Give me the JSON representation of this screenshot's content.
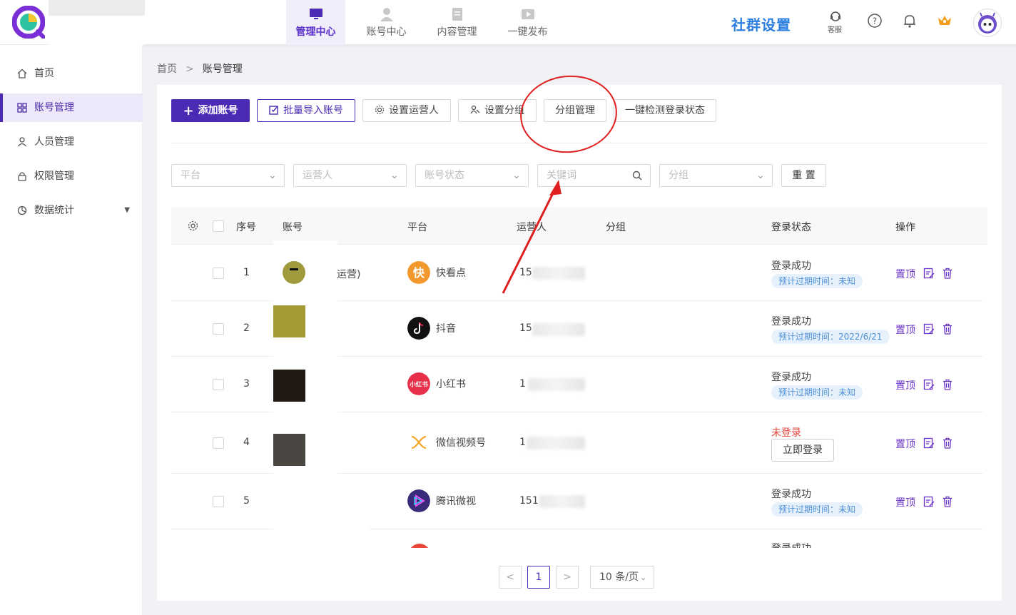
{
  "header": {
    "nav": [
      {
        "label": "管理中心",
        "icon": "monitor-icon",
        "active": true
      },
      {
        "label": "账号中心",
        "icon": "user-icon",
        "active": false
      },
      {
        "label": "内容管理",
        "icon": "document-icon",
        "active": false
      },
      {
        "label": "一键发布",
        "icon": "play-icon",
        "active": false
      }
    ],
    "community_title": "社群设置",
    "kefu_label": "客服"
  },
  "sidebar": {
    "items": [
      {
        "label": "首页",
        "icon": "home-icon"
      },
      {
        "label": "账号管理",
        "icon": "grid-icon",
        "active": true
      },
      {
        "label": "人员管理",
        "icon": "person-icon"
      },
      {
        "label": "权限管理",
        "icon": "lock-icon"
      },
      {
        "label": "数据统计",
        "icon": "chart-icon"
      }
    ]
  },
  "breadcrumb": {
    "home": "首页",
    "sep": ">",
    "current": "账号管理"
  },
  "toolbar": {
    "add": "添加账号",
    "batch_import": "批量导入账号",
    "set_operator": "设置运营人",
    "set_group": "设置分组",
    "group_manage": "分组管理",
    "check_login": "一键检测登录状态"
  },
  "filters": {
    "platform": "平台",
    "operator": "运营人",
    "account_status": "账号状态",
    "keyword_placeholder": "关键词",
    "group": "分组",
    "reset": "重 置"
  },
  "table": {
    "headers": {
      "index": "序号",
      "account": "账号",
      "platform": "平台",
      "operator": "运营人",
      "group": "分组",
      "login_status": "登录状态",
      "actions": "操作"
    },
    "rows": [
      {
        "index": "1",
        "account_suffix": "运营)",
        "platform": "快看点",
        "operator": "15",
        "status": "登录成功",
        "expire": "预计过期时间：未知",
        "top": "置顶"
      },
      {
        "index": "2",
        "account_suffix": "",
        "platform": "抖音",
        "operator": "15",
        "status": "登录成功",
        "expire": "预计过期时间：2022/6/21",
        "top": "置顶"
      },
      {
        "index": "3",
        "account_suffix": "",
        "platform": "小红书",
        "operator": "1",
        "status": "登录成功",
        "expire": "预计过期时间：未知",
        "top": "置顶"
      },
      {
        "index": "4",
        "account_suffix": "",
        "platform": "微信视频号",
        "operator": "1",
        "status": "未登录",
        "login_btn": "立即登录",
        "top": "置顶"
      },
      {
        "index": "5",
        "account_suffix": "",
        "platform": "腾讯微视",
        "operator": "151",
        "status": "登录成功",
        "expire": "预计过期时间：未知",
        "top": "置顶"
      }
    ],
    "partial_status": "登录成功"
  },
  "pagination": {
    "current": "1",
    "prev": "<",
    "next": ">",
    "page_size": "10 条/页"
  },
  "platform_icons": {
    "kuaikandian": {
      "icon_text": "快",
      "color": "#f2992e"
    },
    "douyin": {
      "color": "#111111"
    },
    "xiaohongshu": {
      "icon_text": "小红书",
      "color": "#e8304a"
    },
    "weixin_video": {
      "color": "#f5a623"
    },
    "weishi": {
      "color": "#3a2a7a"
    }
  },
  "colors": {
    "primary": "#4b2bb4",
    "community": "#2b7fe0",
    "error": "#e5463d",
    "annotation": "#e02020"
  }
}
